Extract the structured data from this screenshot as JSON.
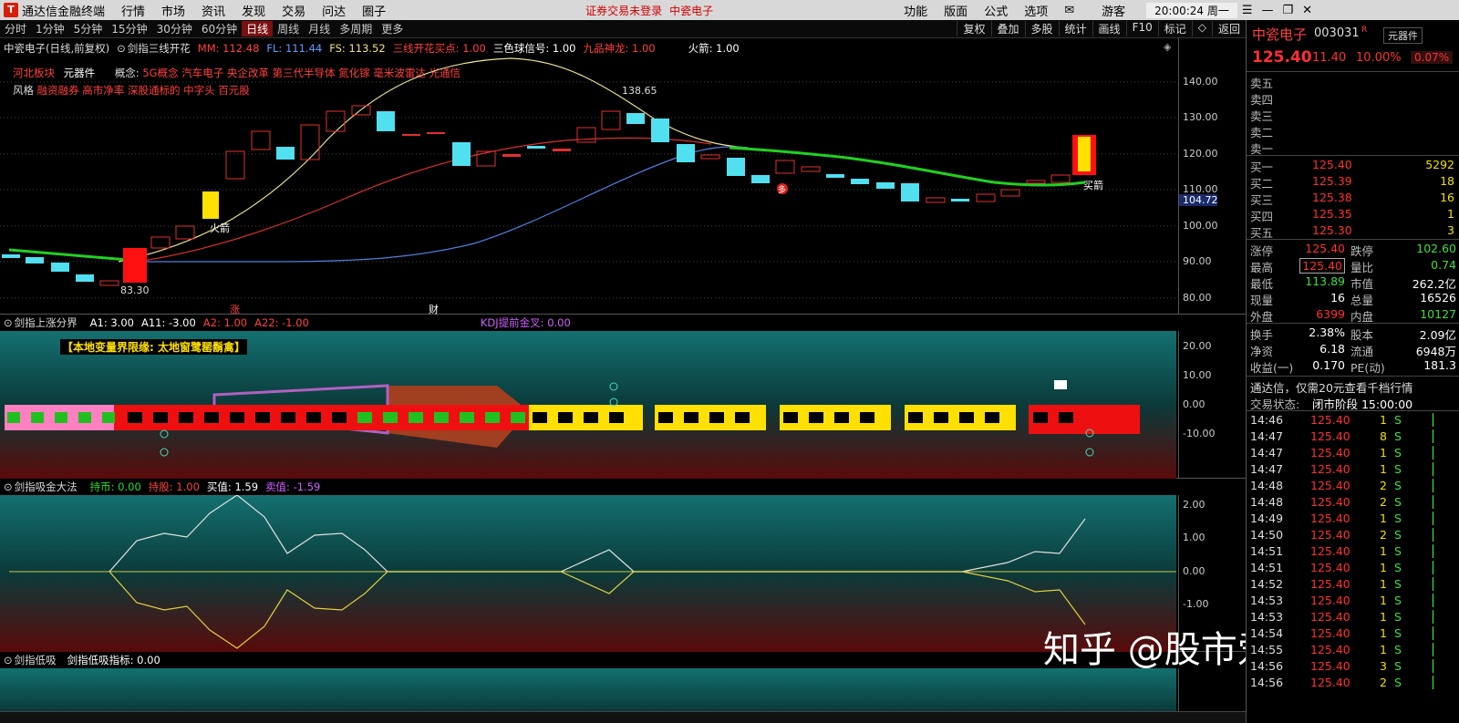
{
  "window": {
    "app_title": "通达信金融终端",
    "menus": [
      "行情",
      "市场",
      "资讯",
      "发现",
      "交易",
      "问达",
      "圈子"
    ],
    "warning": "证券交易未登录",
    "warning_stock": "中瓷电子",
    "right_menus": [
      "功能",
      "版面",
      "公式",
      "选项"
    ],
    "user": "游客",
    "clock": "20:00:24 周一"
  },
  "periods": {
    "items": [
      "分时",
      "1分钟",
      "5分钟",
      "15分钟",
      "30分钟",
      "60分钟",
      "日线",
      "周线",
      "月线",
      "多周期",
      "更多"
    ],
    "active": "日线",
    "right_buttons": [
      "复权",
      "叠加",
      "多股",
      "统计",
      "画线",
      "F10",
      "标记",
      "◇",
      "返回"
    ]
  },
  "main_chart": {
    "stock": "中瓷电子(日线,前复权)",
    "indicator": "剑指三线开花",
    "mm_label": "MM: 112.48",
    "fl_label": "FL: 111.44",
    "fs_label": "FS: 113.52",
    "sx_label": "三线开花买点: 1.00",
    "ball_label": "三色球信号: 1.00",
    "dragon_label": "九品神龙: 1.00",
    "arrow_label": "火箭: 1.00",
    "sector_label": "河北板块",
    "sector_value": "元器件",
    "concept_label": "概念:",
    "concept_value": "5G概念 汽车电子 央企改革 第三代半导体 氮化镓 毫米波雷达 光通信",
    "style_label": "风格",
    "style_value": "融资融券 高市净率 深股通标的 中字头 百元股",
    "high_mark": "138.65",
    "low_mark": "83.30",
    "huojian": "火箭",
    "maijian": "买箭",
    "duo": "多",
    "zhang": "涨",
    "cai": "财",
    "current_price_tag": "104.72",
    "yticks": [
      "140.00",
      "130.00",
      "120.00",
      "110.00",
      "100.00",
      "90.00",
      "80.00"
    ]
  },
  "sub1": {
    "indicator": "剑指上涨分界",
    "a1": "A1: 3.00",
    "a11": "A11: -3.00",
    "a2": "A2: 1.00",
    "a22": "A22: -1.00",
    "kdj": "KDJ提前金叉: 0.00",
    "banner": "【本地变量界限缘: 太地窗鹭罂鬍禽】",
    "yticks": [
      "20.00",
      "10.00",
      "0.00",
      "-10.00"
    ]
  },
  "sub2": {
    "indicator": "剑指吸金大法",
    "chibi": "持币: 0.00",
    "chigu": "持股: 1.00",
    "buy": "买值: 1.59",
    "sell": "卖值: -1.59",
    "yticks": [
      "2.00",
      "1.00",
      "0.00",
      "-1.00"
    ]
  },
  "sub3": {
    "indicator": "剑指低吸",
    "label": "剑指低吸指标: 0.00"
  },
  "watermark": "知乎 @股市爱好者",
  "quote": {
    "name": "中瓷电子",
    "code": "003031",
    "tag_small": "R",
    "sector_btn": "元器件",
    "price": "125.40",
    "change": "11.40",
    "pct": "10.00%",
    "sector_pct": "0.07%",
    "asks": [
      "卖五",
      "卖四",
      "卖三",
      "卖二",
      "卖一"
    ],
    "bids": [
      {
        "label": "买一",
        "price": "125.40",
        "vol": "5292"
      },
      {
        "label": "买二",
        "price": "125.39",
        "vol": "18"
      },
      {
        "label": "买三",
        "price": "125.38",
        "vol": "16"
      },
      {
        "label": "买四",
        "price": "125.35",
        "vol": "1"
      },
      {
        "label": "买五",
        "price": "125.30",
        "vol": "3"
      }
    ],
    "stats": [
      {
        "l1": "涨停",
        "v1": "125.40",
        "c1": "red",
        "l2": "跌停",
        "v2": "102.60",
        "c2": "green"
      },
      {
        "l1": "最高",
        "v1": "125.40",
        "c1": "red",
        "l2": "量比",
        "v2": "0.74",
        "c2": "green"
      },
      {
        "l1": "最低",
        "v1": "113.89",
        "c1": "green",
        "l2": "市值",
        "v2": "262.2亿",
        "c2": "white"
      },
      {
        "l1": "现量",
        "v1": "16",
        "c1": "white",
        "l2": "总量",
        "v2": "16526",
        "c2": "white"
      },
      {
        "l1": "外盘",
        "v1": "6399",
        "c1": "red",
        "l2": "内盘",
        "v2": "10127",
        "c2": "green"
      }
    ],
    "stats2": [
      {
        "l1": "换手",
        "v1": "2.38%",
        "l2": "股本",
        "v2": "2.09亿"
      },
      {
        "l1": "净资",
        "v1": "6.18",
        "l2": "流通",
        "v2": "6948万"
      },
      {
        "l1": "收益(一)",
        "v1": "0.170",
        "l2": "PE(动)",
        "v2": "181.3"
      }
    ],
    "ad": "通达信，仅需20元查看千档行情",
    "status_label": "交易状态:",
    "status_value": "闭市阶段 15:00:00",
    "ticks": [
      {
        "t": "14:46",
        "p": "125.40",
        "v": "1",
        "s": "S"
      },
      {
        "t": "14:47",
        "p": "125.40",
        "v": "8",
        "s": "S"
      },
      {
        "t": "14:47",
        "p": "125.40",
        "v": "1",
        "s": "S"
      },
      {
        "t": "14:47",
        "p": "125.40",
        "v": "1",
        "s": "S"
      },
      {
        "t": "14:48",
        "p": "125.40",
        "v": "2",
        "s": "S"
      },
      {
        "t": "14:48",
        "p": "125.40",
        "v": "2",
        "s": "S"
      },
      {
        "t": "14:49",
        "p": "125.40",
        "v": "1",
        "s": "S"
      },
      {
        "t": "14:50",
        "p": "125.40",
        "v": "2",
        "s": "S"
      },
      {
        "t": "14:51",
        "p": "125.40",
        "v": "1",
        "s": "S"
      },
      {
        "t": "14:51",
        "p": "125.40",
        "v": "1",
        "s": "S"
      },
      {
        "t": "14:52",
        "p": "125.40",
        "v": "1",
        "s": "S"
      },
      {
        "t": "14:53",
        "p": "125.40",
        "v": "1",
        "s": "S"
      },
      {
        "t": "14:53",
        "p": "125.40",
        "v": "1",
        "s": "S"
      },
      {
        "t": "14:54",
        "p": "125.40",
        "v": "1",
        "s": "S"
      },
      {
        "t": "14:55",
        "p": "125.40",
        "v": "1",
        "s": "S"
      },
      {
        "t": "14:56",
        "p": "125.40",
        "v": "3",
        "s": "S"
      },
      {
        "t": "14:56",
        "p": "125.40",
        "v": "2",
        "s": "S"
      }
    ]
  }
}
